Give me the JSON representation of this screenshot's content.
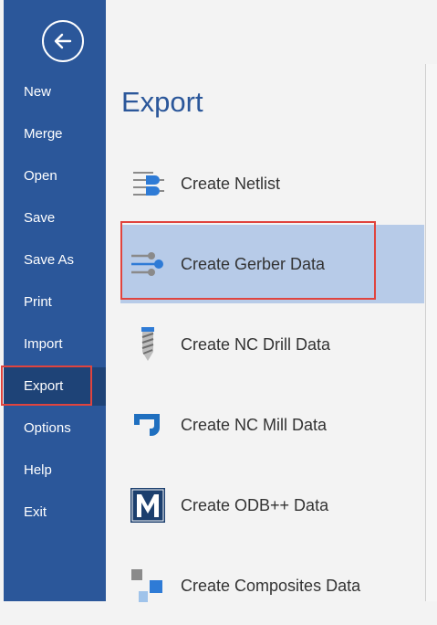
{
  "back_icon": "arrow-left-icon",
  "nav": {
    "items": [
      {
        "label": "New"
      },
      {
        "label": "Merge"
      },
      {
        "label": "Open"
      },
      {
        "label": "Save"
      },
      {
        "label": "Save As"
      },
      {
        "label": "Print"
      },
      {
        "label": "Import"
      },
      {
        "label": "Export",
        "active": true
      },
      {
        "label": "Options"
      },
      {
        "label": "Help"
      },
      {
        "label": "Exit"
      }
    ]
  },
  "main": {
    "title": "Export",
    "items": [
      {
        "label": "Create Netlist",
        "icon": "netlist-icon"
      },
      {
        "label": "Create Gerber Data",
        "icon": "gerber-icon",
        "selected": true
      },
      {
        "label": "Create NC Drill Data",
        "icon": "drill-icon"
      },
      {
        "label": "Create NC Mill Data",
        "icon": "mill-icon"
      },
      {
        "label": "Create ODB++ Data",
        "icon": "odb-icon"
      },
      {
        "label": "Create Composites Data",
        "icon": "composites-icon"
      }
    ]
  },
  "colors": {
    "sidebar": "#2b579a",
    "active_nav": "#1e4377",
    "selected_item": "#b7cbe8",
    "highlight_border": "#e0443e",
    "title": "#2b579a"
  }
}
